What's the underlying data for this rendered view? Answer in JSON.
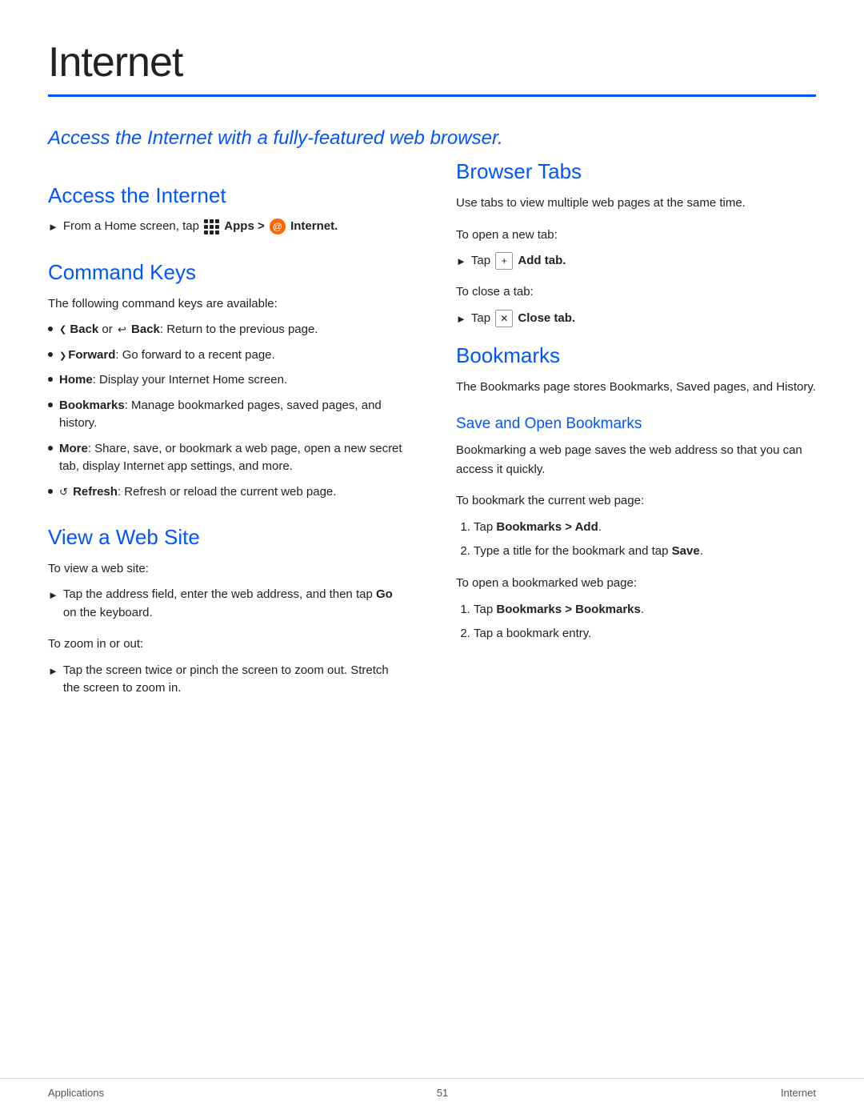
{
  "page": {
    "title": "Internet",
    "footer_left": "Applications",
    "footer_center": "51",
    "footer_right": "Internet"
  },
  "intro": {
    "text": "Access the Internet with a fully-featured web browser."
  },
  "access_internet": {
    "heading": "Access the Internet",
    "step": "From a Home screen, tap",
    "apps_label": "Apps >",
    "internet_label": "Internet."
  },
  "command_keys": {
    "heading": "Command Keys",
    "intro": "The following command keys are available:",
    "items": [
      {
        "label": "Back",
        "suffix": " or ",
        "label2": " Back",
        "desc": ": Return to the previous page."
      },
      {
        "label": "Forward",
        "desc": ": Go forward to a recent page."
      },
      {
        "label": "Home",
        "desc": ": Display your Internet Home screen."
      },
      {
        "label": "Bookmarks",
        "desc": ": Manage bookmarked pages, saved pages, and history."
      },
      {
        "label": "More",
        "desc": ": Share, save, or bookmark a web page, open a new secret tab, display Internet app settings, and more."
      },
      {
        "label": "Refresh",
        "desc": ": Refresh or reload the current web page."
      }
    ]
  },
  "view_web_site": {
    "heading": "View a Web Site",
    "intro": "To view a web site:",
    "step1": "Tap the address field, enter the web address, and then tap",
    "step1_bold": "Go",
    "step1_suffix": "on the keyboard.",
    "zoom_intro": "To zoom in or out:",
    "zoom_step": "Tap the screen twice or pinch the screen to zoom out. Stretch the screen to zoom in."
  },
  "browser_tabs": {
    "heading": "Browser Tabs",
    "desc": "Use tabs to view multiple web pages at the same time.",
    "new_tab_intro": "To open a new tab:",
    "new_tab_step": "Tap",
    "new_tab_bold": "Add tab.",
    "close_tab_intro": "To close a tab:",
    "close_tab_step": "Tap",
    "close_tab_bold": "Close tab."
  },
  "bookmarks": {
    "heading": "Bookmarks",
    "desc": "The Bookmarks page stores Bookmarks, Saved pages, and History.",
    "save_heading": "Save and Open Bookmarks",
    "save_desc": "Bookmarking a web page saves the web address so that you can access it quickly.",
    "bookmark_intro": "To bookmark the current web page:",
    "bookmark_steps": [
      {
        "text": "Tap ",
        "bold": "Bookmarks > Add",
        "suffix": "."
      },
      {
        "text": "Type a title for the bookmark and tap ",
        "bold": "Save",
        "suffix": "."
      }
    ],
    "open_intro": "To open a bookmarked web page:",
    "open_steps": [
      {
        "text": "Tap ",
        "bold": "Bookmarks > Bookmarks",
        "suffix": "."
      },
      {
        "text": "Tap a bookmark entry.",
        "bold": "",
        "suffix": ""
      }
    ]
  }
}
